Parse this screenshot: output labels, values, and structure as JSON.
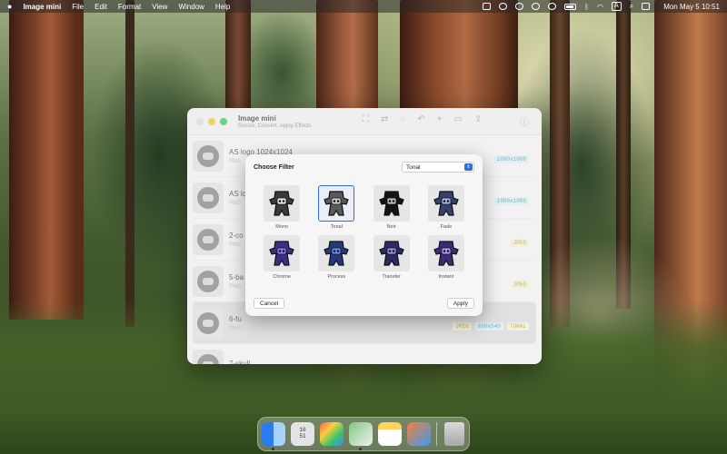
{
  "menubar": {
    "app_name": "Image mini",
    "menus": [
      "File",
      "Edit",
      "Format",
      "View",
      "Window",
      "Help"
    ],
    "clock": "Mon May 5  10:51",
    "input_letter": "A"
  },
  "window": {
    "title": "Image mini",
    "subtitle": "Resize, Convert, Apply Effects",
    "rows": [
      {
        "name": "AS logo 1024x1024",
        "meta": "PNG",
        "badges": [
          {
            "text": "1080x1080",
            "kind": "size"
          }
        ]
      },
      {
        "name": "AS lo",
        "meta": "PNG",
        "badges": [
          {
            "text": "1080x1080",
            "kind": "size"
          }
        ]
      },
      {
        "name": "2-co",
        "meta": "PNG",
        "badges": [
          {
            "text": "JPEG",
            "kind": "fmt"
          }
        ]
      },
      {
        "name": "5-ba",
        "meta": "PNG",
        "badges": [
          {
            "text": "JPEG",
            "kind": "fmt"
          }
        ]
      },
      {
        "name": "6-fu",
        "meta": "PNG",
        "badges": [
          {
            "text": "JPEG",
            "kind": "fmt"
          },
          {
            "text": "680x540",
            "kind": "size"
          },
          {
            "text": "TONAL",
            "kind": "fmt"
          }
        ]
      },
      {
        "name": "7-skull",
        "meta": "",
        "badges": []
      }
    ]
  },
  "dialog": {
    "title": "Choose Filter",
    "selected_filter": "Tonal",
    "filters": [
      {
        "label": "Mono",
        "fill": "#3a3a3a",
        "accent": "#e6e6e6"
      },
      {
        "label": "Tonal",
        "fill": "#5a5a5a",
        "accent": "#cfcfcf"
      },
      {
        "label": "Noir",
        "fill": "#141414",
        "accent": "#bdbdbd"
      },
      {
        "label": "Fade",
        "fill": "#34406e",
        "accent": "#a9b6e8"
      },
      {
        "label": "Chrome",
        "fill": "#3b2f86",
        "accent": "#8a7ef0"
      },
      {
        "label": "Process",
        "fill": "#233a7a",
        "accent": "#6c8cf0"
      },
      {
        "label": "Transfer",
        "fill": "#2c2a66",
        "accent": "#9a93d8"
      },
      {
        "label": "Instant",
        "fill": "#3d2a78",
        "accent": "#b49af0"
      }
    ],
    "cancel_label": "Cancel",
    "apply_label": "Apply",
    "accent_color": "#2f6fd9"
  },
  "dock": {
    "clock_top": "10",
    "clock_bottom": "51"
  }
}
